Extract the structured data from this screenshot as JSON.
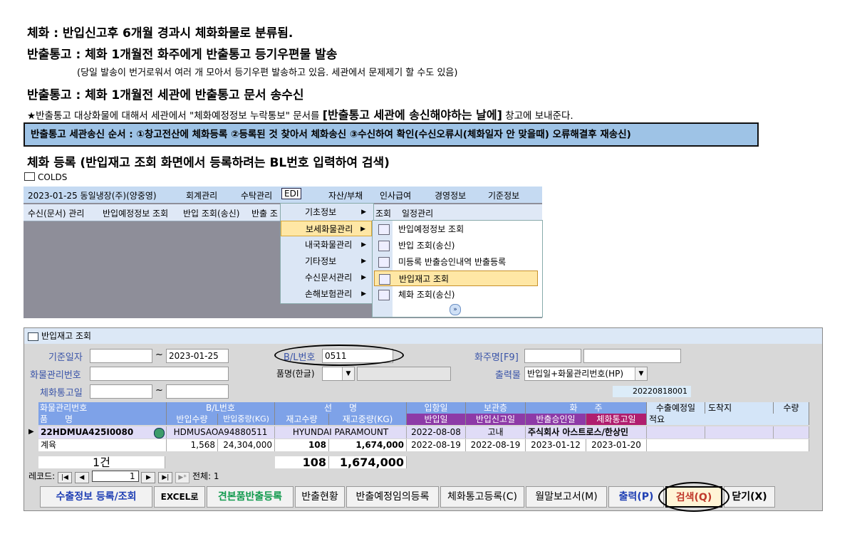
{
  "notes": {
    "line1": "체화 : 반입신고후 6개월 경과시 체화화물로 분류됨.",
    "line2": "반출통고 : 체화 1개월전 화주에게 반출통고 등기우편물 발송",
    "line2_sub": "(당일 발송이 번거로워서 여러 개 모아서 등기우편 발송하고 있음. 세관에서 문제제기 할 수도 있음)",
    "line3": "반출통고 : 체화 1개월전 세관에 반출통고 문서 송수신",
    "star_pre": "★반출통고 대상화물에 대해서 세관에서 \"체화예정정보 누락통보\" 문서를",
    "star_bold": "[반출통고 세관에 송신해야하는 날에]",
    "star_post": "창고에 보내준다.",
    "box": "반출통고 세관송신 순서 : ①창고전산에 체화등록 ②등록된 것 찾아서 체화송신 ③수신하여 확인(수신오류시(체화일자 안 맞을때) 오류해결후 재송신)",
    "line4": "체화 등록 (반입재고 조회 화면에서 등록하려는 BL번호 입력하여 검색)",
    "colds": "COLDS"
  },
  "app": {
    "menubar": [
      "2023-01-25 동일냉장(주)(양중영)",
      "회계관리",
      "수탁관리",
      "EDI",
      "자산/부채",
      "인사급여",
      "경영정보",
      "기준정보"
    ],
    "toolbar": [
      "수신(문서) 관리",
      "반입예정정보 조회",
      "반입 조회(송신)",
      "반출 조",
      "조회",
      "일정관리"
    ],
    "edi_menu": [
      "기초정보",
      "보세화물관리",
      "내국화물관리",
      "기타정보",
      "수신문서관리",
      "손해보험관리"
    ],
    "sub_menu": [
      "반입예정정보 조회",
      "반입 조회(송신)",
      "미등록 반출승인내역 반출등록",
      "반입재고 조회",
      "체화 조회(송신)"
    ]
  },
  "form": {
    "title": "반입재고 조회",
    "labels": {
      "base_date": "기준일자",
      "tilde": "~",
      "bl_no": "B/L번호",
      "owner": "화주명[F9]",
      "cargo_no": "화물관리번호",
      "item_name": "품명(한글)",
      "output_order": "출력물",
      "notice_date": "체화통고일"
    },
    "values": {
      "base_date_to": "2023-01-25",
      "bl_no": "0511",
      "output_order": "반입일+화물관리번호(HP)",
      "code": "20220818001"
    },
    "header_row1": [
      "화물관리번호",
      "B/L번호",
      "선",
      "명",
      "입항일",
      "보관층",
      "화",
      "주",
      "수출예정일",
      "도착지",
      "수량"
    ],
    "header_row2": [
      "품",
      "명",
      "반입수량",
      "반입중량(KG)",
      "재고수량",
      "재고중량(KG)",
      "반입일",
      "반입신고일",
      "반출승인일",
      "체화통고일",
      "적요"
    ],
    "row1": [
      "22HDMUA425I0080",
      "HDMUSAOA94880511",
      "HYUNDAI PARAMOUNT",
      "2022-08-08",
      "고내",
      "주식회사 아스트로스/한상민"
    ],
    "row2": [
      "계육",
      "1,568",
      "24,304,000",
      "108",
      "1,674,000",
      "2022-08-19",
      "2022-08-19",
      "2023-01-12",
      "2023-01-20"
    ],
    "summary": {
      "count": "1건",
      "qty": "108",
      "weight": "1,674,000"
    },
    "record_nav": {
      "label": "레코드:",
      "current": "1",
      "total": "전체: 1"
    },
    "buttons": [
      "수출정보 등록/조회",
      "EXCEL로",
      "견본품반출등록",
      "반출현황",
      "반출예정임의등록",
      "체화통고등록(C)",
      "월말보고서(M)",
      "출력(P)",
      "검색(Q)",
      "닫기(X)"
    ]
  }
}
